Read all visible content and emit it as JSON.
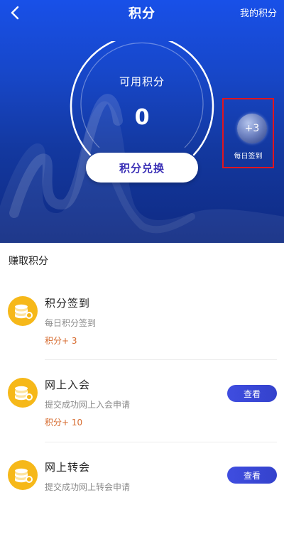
{
  "header": {
    "title": "积分",
    "right_link": "我的积分"
  },
  "summary": {
    "available_label": "可用积分",
    "points": "0",
    "exchange_button": "积分兑换"
  },
  "daily_checkin": {
    "badge": "+3",
    "label": "每日签到"
  },
  "earn": {
    "section_title": "赚取积分",
    "tasks": [
      {
        "title": "积分签到",
        "desc": "每日积分签到",
        "reward": "积分+ 3"
      },
      {
        "title": "网上入会",
        "desc": "提交成功网上入会申请",
        "reward": "积分+ 10",
        "button": "查看"
      },
      {
        "title": "网上转会",
        "desc": "提交成功网上转会申请",
        "button": "查看"
      }
    ]
  },
  "colors": {
    "hero_top": "#1850e8",
    "hero_bottom": "#0f2a82",
    "button_text": "#3b30b6",
    "reward_text": "#d66a2d",
    "highlight_border": "#e0151f",
    "view_button": "#3f4de0"
  },
  "icons": {
    "back": "chevron-left-icon",
    "task": "coin-stack-icon"
  }
}
